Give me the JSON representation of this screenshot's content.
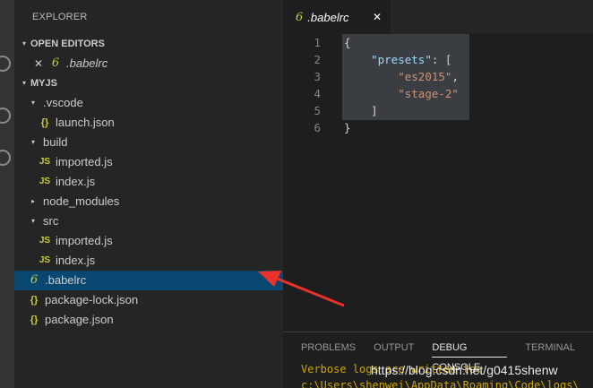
{
  "sidebar": {
    "title": "EXPLORER",
    "open_editors": {
      "header": "OPEN EDITORS",
      "items": [
        {
          "close": "✕",
          "label": ".babelrc"
        }
      ]
    },
    "workspace": {
      "header": "MYJS",
      "tree": [
        {
          "label": ".vscode",
          "kind": "folder-open",
          "depth": 1
        },
        {
          "label": "launch.json",
          "kind": "json",
          "depth": 2
        },
        {
          "label": "build",
          "kind": "folder-open",
          "depth": 1
        },
        {
          "label": "imported.js",
          "kind": "js",
          "depth": 2
        },
        {
          "label": "index.js",
          "kind": "js",
          "depth": 2
        },
        {
          "label": "node_modules",
          "kind": "folder-closed",
          "depth": 1
        },
        {
          "label": "src",
          "kind": "folder-open",
          "depth": 1
        },
        {
          "label": "imported.js",
          "kind": "js",
          "depth": 2
        },
        {
          "label": "index.js",
          "kind": "js",
          "depth": 2
        },
        {
          "label": ".babelrc",
          "kind": "babel",
          "depth": 1,
          "selected": true
        },
        {
          "label": "package-lock.json",
          "kind": "json",
          "depth": 1
        },
        {
          "label": "package.json",
          "kind": "json",
          "depth": 1
        }
      ]
    }
  },
  "editor": {
    "tab": {
      "label": ".babelrc",
      "close": "✕"
    },
    "lines": [
      {
        "num": "1",
        "parts": [
          {
            "t": "{",
            "c": "punc"
          }
        ]
      },
      {
        "num": "2",
        "parts": [
          {
            "t": "    ",
            "c": "punc"
          },
          {
            "t": "\"presets\"",
            "c": "key"
          },
          {
            "t": ": [",
            "c": "punc"
          }
        ]
      },
      {
        "num": "3",
        "parts": [
          {
            "t": "        ",
            "c": "punc"
          },
          {
            "t": "\"es2015\"",
            "c": "str"
          },
          {
            "t": ",",
            "c": "punc"
          }
        ]
      },
      {
        "num": "4",
        "parts": [
          {
            "t": "        ",
            "c": "punc"
          },
          {
            "t": "\"stage-2\"",
            "c": "str"
          }
        ]
      },
      {
        "num": "5",
        "parts": [
          {
            "t": "    ]",
            "c": "punc"
          }
        ]
      },
      {
        "num": "6",
        "parts": [
          {
            "t": "}",
            "c": "punc"
          }
        ]
      }
    ]
  },
  "panel": {
    "tabs": [
      "PROBLEMS",
      "OUTPUT",
      "DEBUG CONSOLE",
      "TERMINAL"
    ],
    "active_tab": "DEBUG CONSOLE",
    "log": [
      "Verbose logs are written to:",
      "c:\\Users\\shenwei\\AppData\\Roaming\\Code\\logs\\"
    ]
  },
  "watermark": "https://blog.csdn.net/g0415shenw",
  "icons": {
    "chevron-down": "▾",
    "chevron-right": "▸",
    "json": "{}",
    "js": "JS",
    "babel": "6"
  },
  "colors": {
    "selection": "#094771",
    "arrow": "#e8322a",
    "accent": "#cbcb41"
  }
}
